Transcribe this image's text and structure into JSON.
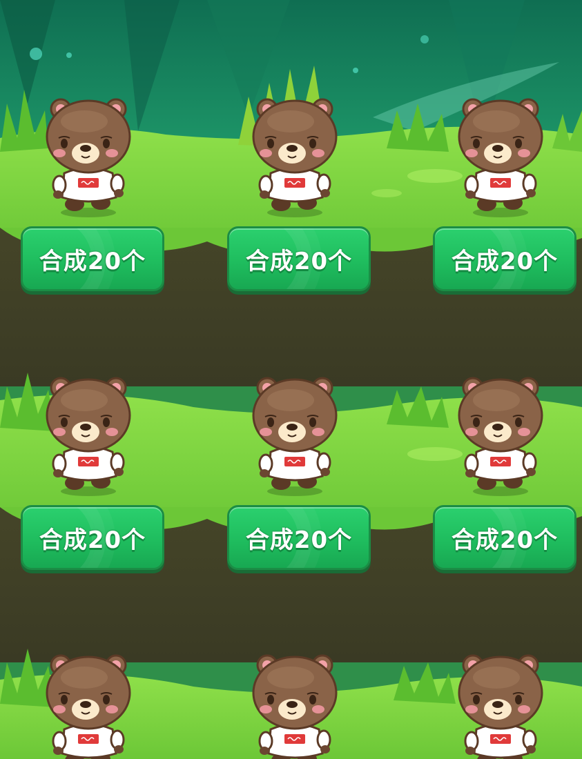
{
  "scene": {
    "theme": "forest",
    "colors": {
      "sky_top": "#0f6e52",
      "sky_mid": "#1f9a6a",
      "grass": "#7fd640",
      "grass_dark": "#4fae2a",
      "soil": "#4a4a30",
      "soil_dark": "#3b3a26",
      "button_green": "#1fbd5e",
      "button_border": "#1b8d45"
    }
  },
  "grid": {
    "rows": [
      {
        "cells": [
          {
            "character": "brown-bear-white-shirt",
            "button_label": "合成20个"
          },
          {
            "character": "brown-bear-white-shirt",
            "button_label": "合成20个"
          },
          {
            "character": "brown-bear-white-shirt",
            "button_label": "合成20个"
          }
        ]
      },
      {
        "cells": [
          {
            "character": "brown-bear-white-shirt",
            "button_label": "合成20个"
          },
          {
            "character": "brown-bear-white-shirt",
            "button_label": "合成20个"
          },
          {
            "character": "brown-bear-white-shirt",
            "button_label": "合成20个"
          }
        ]
      },
      {
        "cells": [
          {
            "character": "brown-bear-white-shirt"
          },
          {
            "character": "brown-bear-white-shirt"
          },
          {
            "character": "brown-bear-white-shirt"
          }
        ]
      }
    ]
  }
}
